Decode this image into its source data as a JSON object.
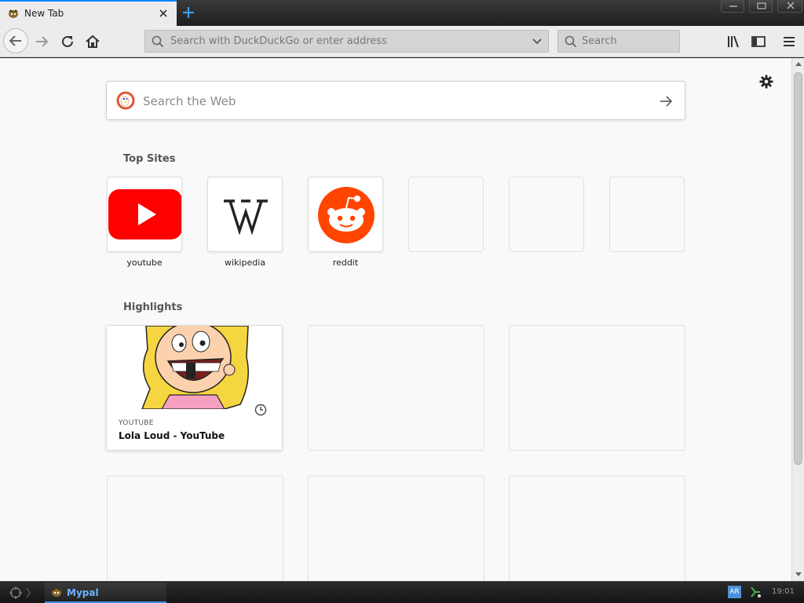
{
  "browser": {
    "tab": {
      "title": "New Tab"
    },
    "urlbar": {
      "placeholder": "Search with DuckDuckGo or enter address"
    },
    "searchbar": {
      "placeholder": "Search"
    }
  },
  "newtab": {
    "search_placeholder": "Search the Web",
    "topsites_title": "Top Sites",
    "topsites": [
      {
        "label": "youtube",
        "icon": "youtube-logo"
      },
      {
        "label": "wikipedia",
        "icon": "wikipedia-logo"
      },
      {
        "label": "reddit",
        "icon": "reddit-logo"
      }
    ],
    "highlights_title": "Highlights",
    "highlight": {
      "source": "YOUTUBE",
      "title": "Lola Loud - YouTube"
    }
  },
  "taskbar": {
    "app_label": "Mypal",
    "language": "AR",
    "time": "19:01"
  },
  "colors": {
    "accent": "#0a84ff",
    "youtube_red": "#ff0000",
    "reddit_orange": "#ff4500"
  }
}
